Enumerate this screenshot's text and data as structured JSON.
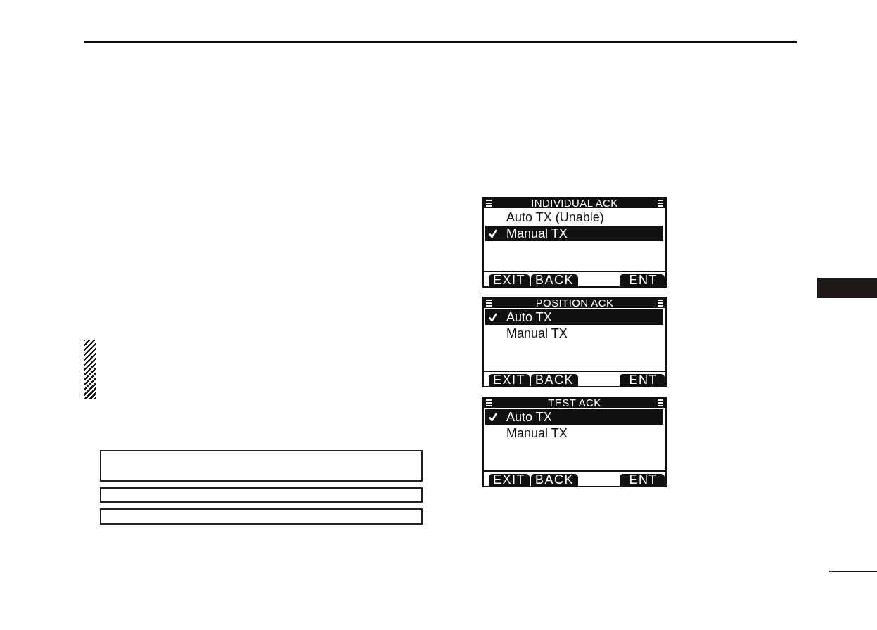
{
  "screens": [
    {
      "title": "INDIVIDUAL ACK",
      "options": [
        {
          "label": "Auto TX (Unable)",
          "selected": false
        },
        {
          "label": "Manual TX",
          "selected": true
        }
      ],
      "softkeys": [
        "EXIT",
        "BACK",
        "ENT"
      ]
    },
    {
      "title": "POSITION ACK",
      "options": [
        {
          "label": "Auto TX",
          "selected": true
        },
        {
          "label": "Manual TX",
          "selected": false
        }
      ],
      "softkeys": [
        "EXIT",
        "BACK",
        "ENT"
      ]
    },
    {
      "title": "TEST ACK",
      "options": [
        {
          "label": "Auto TX",
          "selected": true
        },
        {
          "label": "Manual TX",
          "selected": false
        }
      ],
      "softkeys": [
        "EXIT",
        "BACK",
        "ENT"
      ]
    }
  ]
}
